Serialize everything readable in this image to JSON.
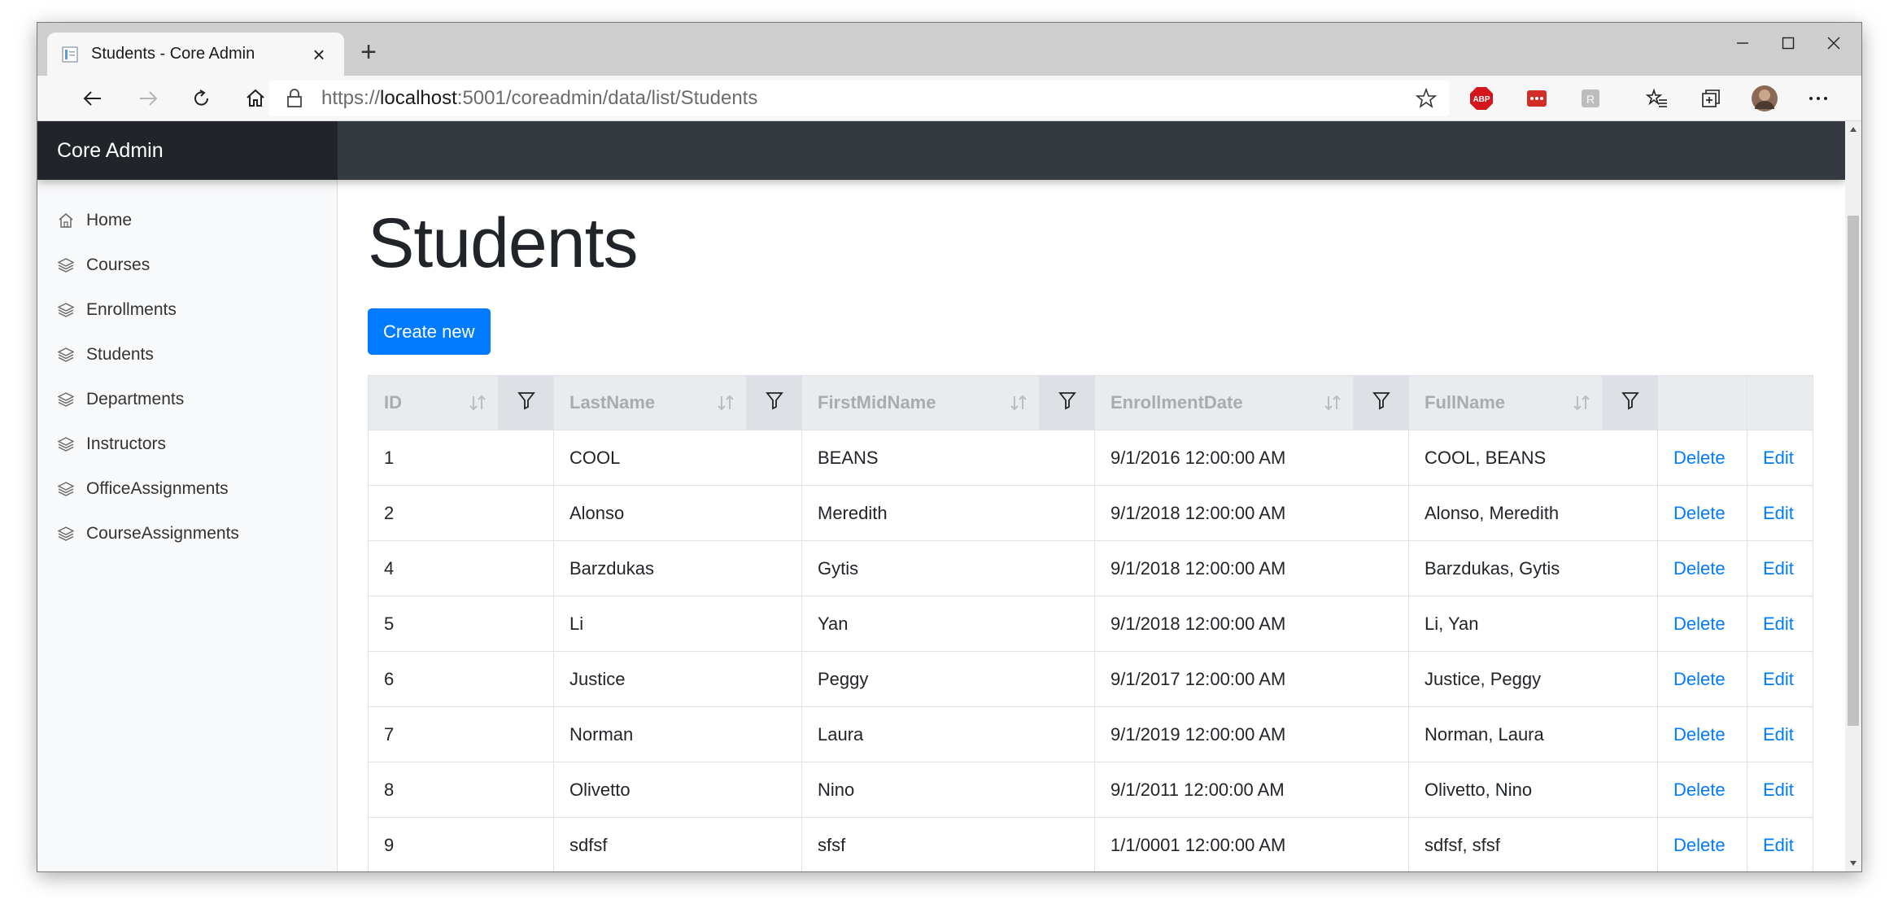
{
  "browser": {
    "tab_title": "Students - Core Admin",
    "url_prefix": "https://",
    "url_host": "localhost",
    "url_rest": ":5001/coreadmin/data/list/Students",
    "new_tab": "+",
    "tab_close": "×",
    "extensions": [
      "abp-icon",
      "lastpass-icon",
      "translate-icon",
      "favorites-icon",
      "collections-icon",
      "profile-avatar",
      "more-icon"
    ]
  },
  "navbar": {
    "brand": "Core Admin",
    "dark_color": "#343a40",
    "brand_bg": "#212529"
  },
  "sidebar": {
    "items": [
      {
        "label": "Home",
        "icon": "home-icon"
      },
      {
        "label": "Courses",
        "icon": "layers-icon"
      },
      {
        "label": "Enrollments",
        "icon": "layers-icon"
      },
      {
        "label": "Students",
        "icon": "layers-icon"
      },
      {
        "label": "Departments",
        "icon": "layers-icon"
      },
      {
        "label": "Instructors",
        "icon": "layers-icon"
      },
      {
        "label": "OfficeAssignments",
        "icon": "layers-icon"
      },
      {
        "label": "CourseAssignments",
        "icon": "layers-icon"
      }
    ]
  },
  "main": {
    "title": "Students",
    "create_label": "Create new",
    "accent": "#007bff"
  },
  "table": {
    "columns": [
      "ID",
      "LastName",
      "FirstMidName",
      "EnrollmentDate",
      "FullName"
    ],
    "delete_label": "Delete",
    "edit_label": "Edit",
    "rows": [
      [
        "1",
        "COOL",
        "BEANS",
        "9/1/2016 12:00:00 AM",
        "COOL, BEANS"
      ],
      [
        "2",
        "Alonso",
        "Meredith",
        "9/1/2018 12:00:00 AM",
        "Alonso, Meredith"
      ],
      [
        "4",
        "Barzdukas",
        "Gytis",
        "9/1/2018 12:00:00 AM",
        "Barzdukas, Gytis"
      ],
      [
        "5",
        "Li",
        "Yan",
        "9/1/2018 12:00:00 AM",
        "Li, Yan"
      ],
      [
        "6",
        "Justice",
        "Peggy",
        "9/1/2017 12:00:00 AM",
        "Justice, Peggy"
      ],
      [
        "7",
        "Norman",
        "Laura",
        "9/1/2019 12:00:00 AM",
        "Norman, Laura"
      ],
      [
        "8",
        "Olivetto",
        "Nino",
        "9/1/2011 12:00:00 AM",
        "Olivetto, Nino"
      ],
      [
        "9",
        "sdfsf",
        "sfsf",
        "1/1/0001 12:00:00 AM",
        "sdfsf, sfsf"
      ]
    ]
  }
}
